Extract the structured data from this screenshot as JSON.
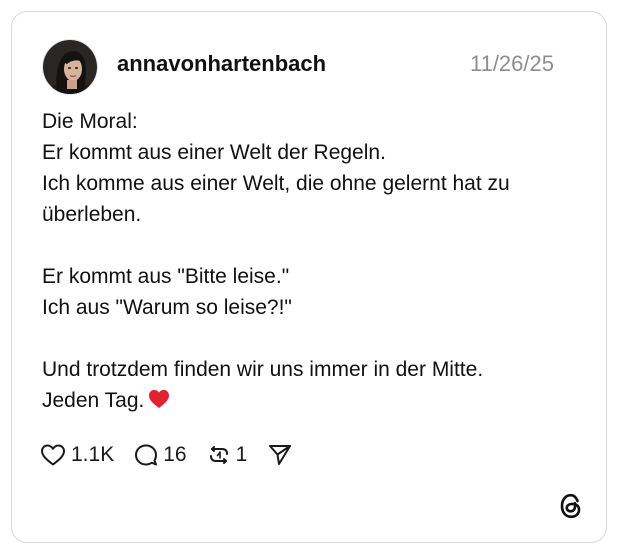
{
  "post": {
    "username": "annavonhartenbach",
    "date": "11/26/25",
    "lines": [
      "Die Moral:",
      "Er kommt aus einer Welt der Regeln.",
      "Ich komme aus einer Welt, die ohne gelernt hat zu",
      "überleben.",
      "",
      "Er kommt aus \"Bitte leise.\"",
      "Ich aus \"Warum so leise?!\"",
      "",
      "Und trotzdem finden wir uns immer in der Mitte.",
      "Jeden Tag."
    ],
    "emoji": "red-heart-emoji"
  },
  "actions": {
    "likes": "1.1K",
    "comments": "16",
    "reposts": "1"
  },
  "icons": {
    "like": "heart-icon",
    "comment": "comment-icon",
    "repost": "repost-icon",
    "share": "send-icon",
    "brand": "threads-logo-icon"
  },
  "colors": {
    "text": "#111111",
    "muted": "#8e8e8e",
    "border": "#d9d9d9",
    "heart": "#e0242f"
  }
}
